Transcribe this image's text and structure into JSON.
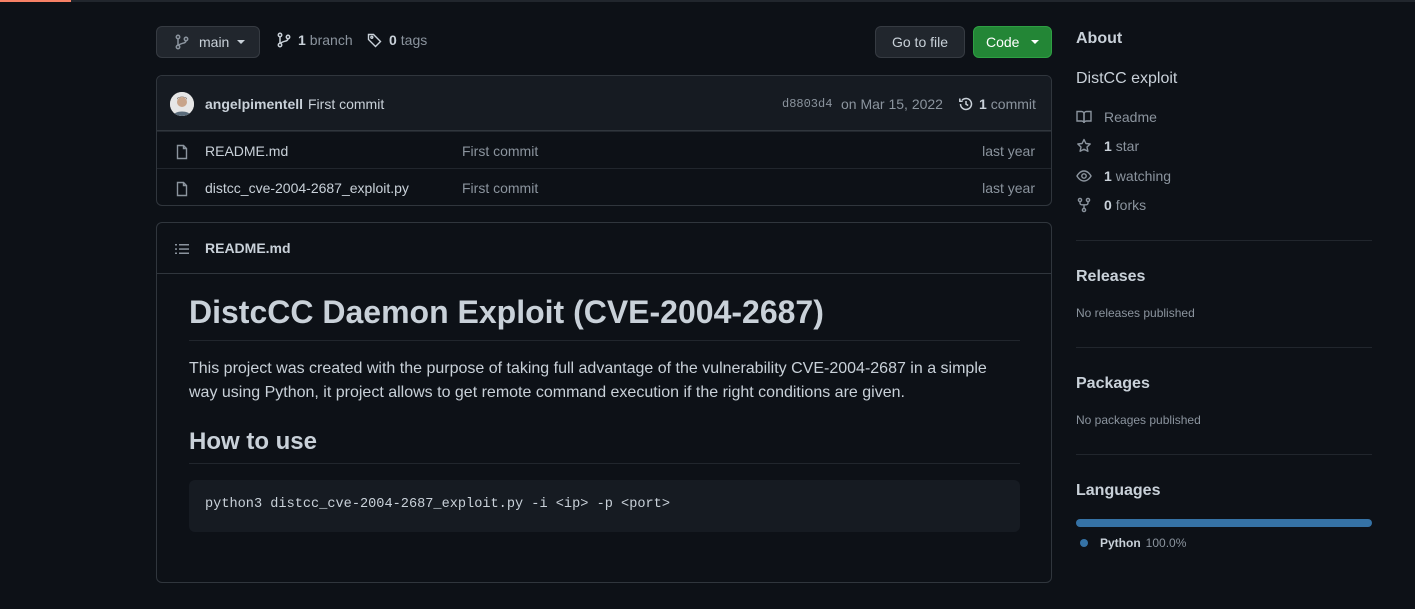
{
  "toolbar": {
    "branch_name": "main",
    "branch_count": "1",
    "branch_label": "branch",
    "tag_count": "0",
    "tag_label": "tags",
    "goto_file_label": "Go to file",
    "code_label": "Code"
  },
  "latest_commit": {
    "author": "angelpimentell",
    "message": "First commit",
    "sha": "d8803d4",
    "date": "on Mar 15, 2022",
    "count": "1",
    "count_label": "commit"
  },
  "files": [
    {
      "name": "README.md",
      "commit": "First commit",
      "age": "last year"
    },
    {
      "name": "distcc_cve-2004-2687_exploit.py",
      "commit": "First commit",
      "age": "last year"
    }
  ],
  "readme": {
    "filename": "README.md",
    "h1": "DistcCC Daemon Exploit (CVE-2004-2687)",
    "paragraph": "This project was created with the purpose of taking full advantage of the vulnerability CVE-2004-2687 in a simple way using Python, it project allows to get remote command execution if the right conditions are given.",
    "h2": "How to use",
    "code": "python3 distcc_cve-2004-2687_exploit.py -i <ip> -p <port>"
  },
  "about": {
    "heading": "About",
    "description": "DistCC exploit",
    "readme_label": "Readme",
    "stars_count": "1",
    "stars_label": "star",
    "watching_count": "1",
    "watching_label": "watching",
    "forks_count": "0",
    "forks_label": "forks"
  },
  "releases": {
    "heading": "Releases",
    "empty": "No releases published"
  },
  "packages": {
    "heading": "Packages",
    "empty": "No packages published"
  },
  "languages": {
    "heading": "Languages",
    "items": [
      {
        "name": "Python",
        "percent": "100.0%",
        "color": "#3572a5"
      }
    ]
  },
  "colors": {
    "accent_green": "#238636",
    "progress": "#f78166",
    "python": "#3572a5"
  }
}
